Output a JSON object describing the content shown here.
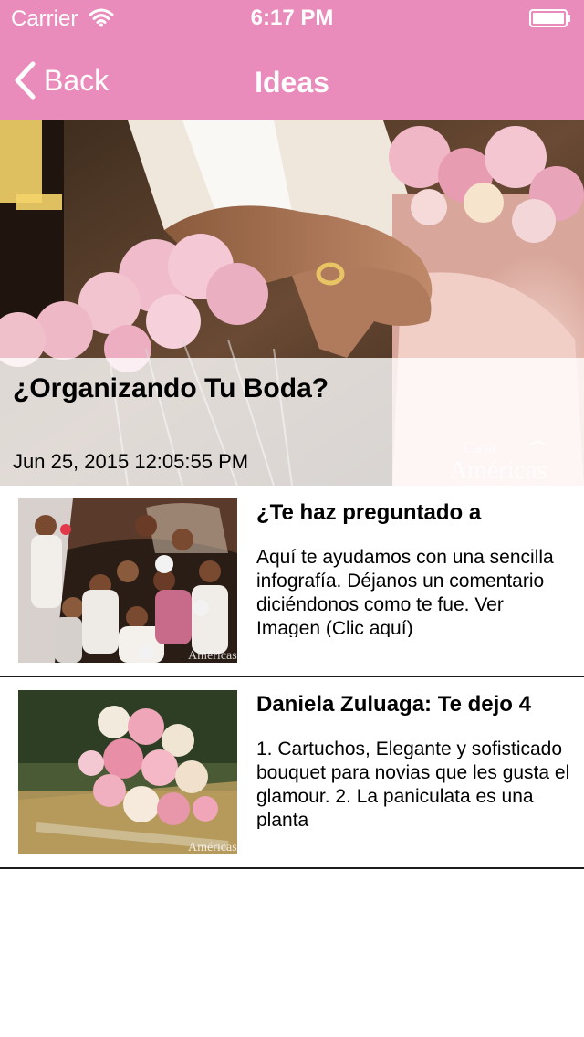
{
  "status_bar": {
    "carrier": "Carrier",
    "time": "6:17 PM"
  },
  "nav_bar": {
    "back_label": "Back",
    "title": "Ideas"
  },
  "featured": {
    "title": "¿Organizando Tu Boda?",
    "date": "Jun 25, 2015 12:05:55 PM",
    "watermark_line1": "Casa",
    "watermark_line2": "Américas"
  },
  "posts": [
    {
      "title": "¿Te haz preguntado a",
      "excerpt": "Aquí te ayudamos con una sencilla infografía. Déjanos un comentario diciéndonos como te fue. Ver Imagen (Clic aquí)",
      "watermark": "Américas"
    },
    {
      "title": "Daniela Zuluaga: Te dejo 4",
      "excerpt": "1. Cartuchos, Elegante y sofisticado bouquet para novias que les gusta el glamour. 2. La paniculata es una planta",
      "watermark": "Américas"
    }
  ],
  "colors": {
    "accent": "#e98cbb",
    "divider": "#1c1c1c"
  },
  "icons": [
    "wifi-icon",
    "battery-icon",
    "back-chevron-icon"
  ]
}
